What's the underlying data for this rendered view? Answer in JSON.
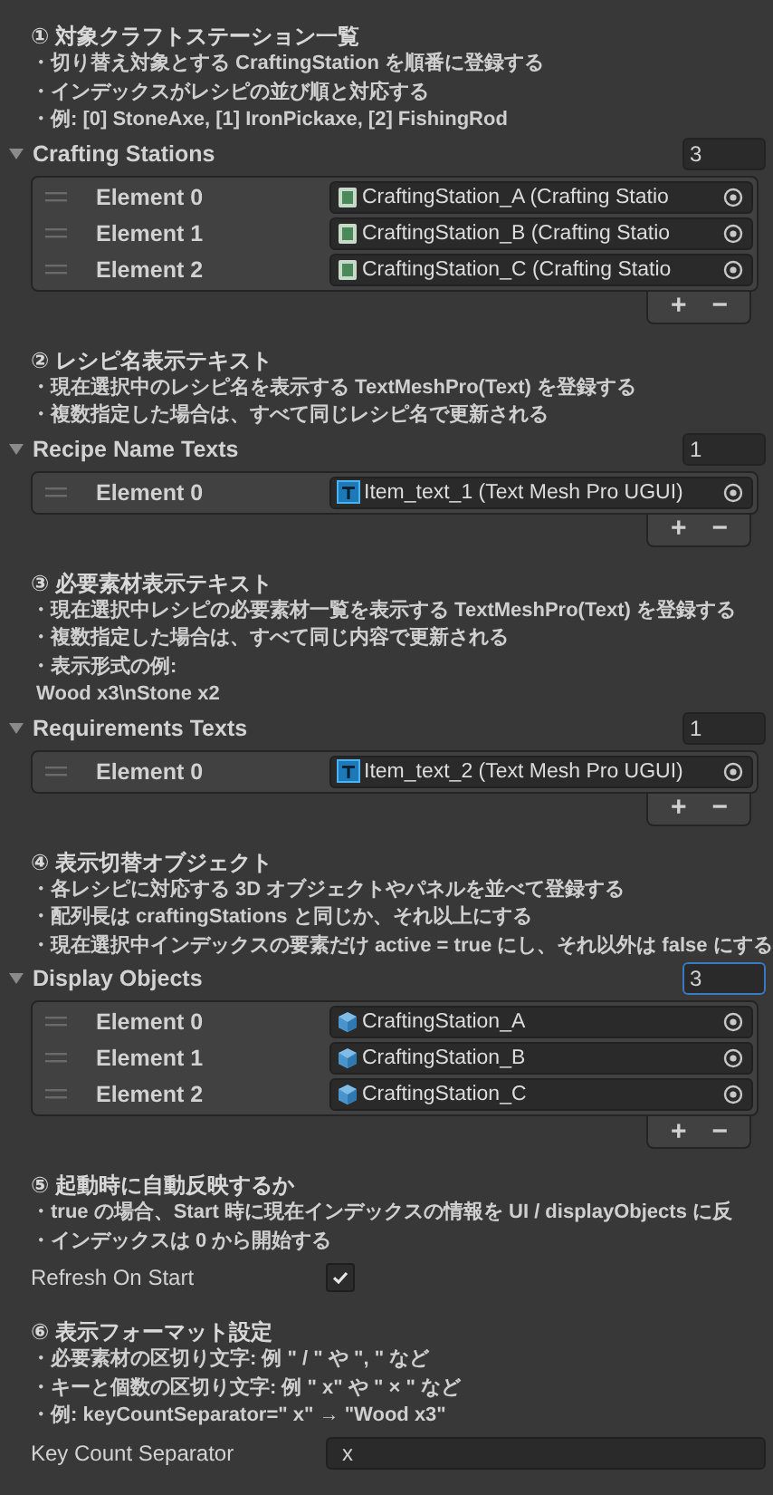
{
  "sections": [
    {
      "title": "① 対象クラフトステーション一覧",
      "lines": [
        "・切り替え対象とする CraftingStation を順番に登録する",
        "・インデックスがレシピの並び順と対応する",
        "・例: [0] StoneAxe, [1] IronPickaxe, [2] FishingRod"
      ],
      "field": {
        "kind": "array",
        "label": "Crafting Stations",
        "expanded": true,
        "count": "3",
        "focused": false,
        "buttons": [
          "+",
          "−"
        ],
        "elements": [
          {
            "label": "Element 0",
            "value": "CraftingStation_A (Crafting Statio",
            "kind": "script"
          },
          {
            "label": "Element 1",
            "value": "CraftingStation_B (Crafting Statio",
            "kind": "script"
          },
          {
            "label": "Element 2",
            "value": "CraftingStation_C (Crafting Statio",
            "kind": "script"
          }
        ]
      }
    },
    {
      "title": "② レシピ名表示テキスト",
      "lines": [
        "・現在選択中のレシピ名を表示する TextMeshPro(Text) を登録する",
        "・複数指定した場合は、すべて同じレシピ名で更新される"
      ],
      "field": {
        "kind": "array",
        "label": "Recipe Name Texts",
        "expanded": true,
        "count": "1",
        "focused": false,
        "buttons": [
          "+",
          "−"
        ],
        "elements": [
          {
            "label": "Element 0",
            "value": "Item_text_1 (Text Mesh Pro UGUI)",
            "kind": "text"
          }
        ]
      }
    },
    {
      "title": "③ 必要素材表示テキスト",
      "lines": [
        "・現在選択中レシピの必要素材一覧を表示する TextMeshPro(Text) を登録する",
        "・複数指定した場合は、すべて同じ内容で更新される",
        "・表示形式の例:",
        " Wood x3\\nStone x2"
      ],
      "field": {
        "kind": "array",
        "label": "Requirements Texts",
        "expanded": true,
        "count": "1",
        "focused": false,
        "buttons": [
          "+",
          "−"
        ],
        "elements": [
          {
            "label": "Element 0",
            "value": "Item_text_2 (Text Mesh Pro UGUI)",
            "kind": "text"
          }
        ]
      }
    },
    {
      "title": "④ 表示切替オブジェクト",
      "lines": [
        "・各レシピに対応する 3D オブジェクトやパネルを並べて登録する",
        "・配列長は craftingStations と同じか、それ以上にする",
        "・現在選択中インデックスの要素だけ active = true にし、それ以外は false にする"
      ],
      "field": {
        "kind": "array",
        "label": "Display Objects",
        "expanded": true,
        "count": "3",
        "focused": true,
        "buttons": [
          "+",
          "−"
        ],
        "elements": [
          {
            "label": "Element 0",
            "value": "CraftingStation_A",
            "kind": "gameobject"
          },
          {
            "label": "Element 1",
            "value": "CraftingStation_B",
            "kind": "gameobject"
          },
          {
            "label": "Element 2",
            "value": "CraftingStation_C",
            "kind": "gameobject"
          }
        ]
      }
    },
    {
      "title": "⑤ 起動時に自動反映するか",
      "lines": [
        "・true の場合、Start 時に現在インデックスの情報を UI / displayObjects に反",
        "・インデックスは 0 から開始する"
      ],
      "field": {
        "kind": "toggle",
        "label": "Refresh On Start",
        "checked": true
      }
    },
    {
      "title": "⑥ 表示フォーマット設定",
      "lines": [
        "・必要素材の区切り文字: 例 \" / \" や \", \" など",
        "・キーと個数の区切り文字: 例 \" x\" や \" × \" など",
        "・例: keyCountSeparator=\" x\" → \"Wood x3\""
      ],
      "field": {
        "kind": "text",
        "label": "Key Count Separator",
        "value": "x"
      }
    }
  ]
}
